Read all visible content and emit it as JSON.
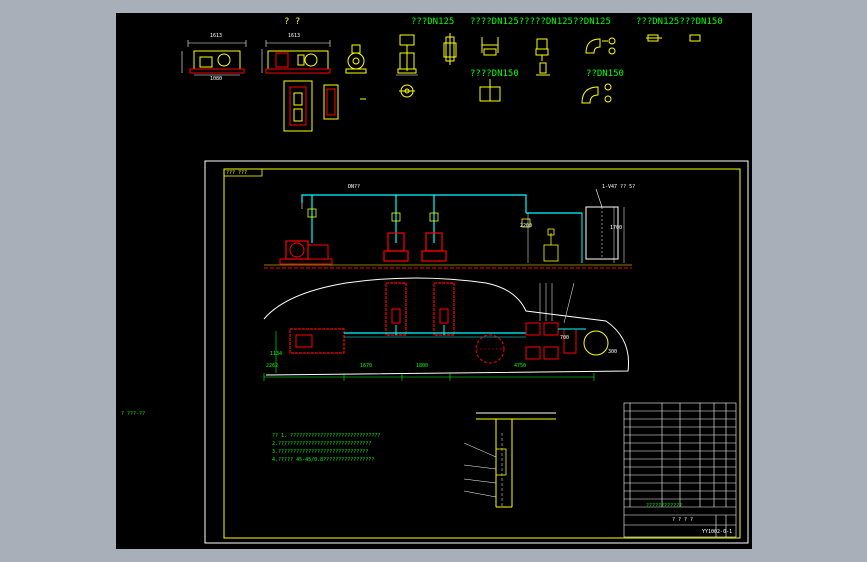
{
  "viewer": {
    "background": "#a9afb8",
    "canvas_color": "#000000"
  },
  "top_title": "? ?",
  "view_labels": [
    {
      "text": "???DN125"
    },
    {
      "text": "????DN125?????DN125??DN125"
    },
    {
      "text": "???DN125???DN150"
    },
    {
      "text": "????DN150"
    },
    {
      "text": "??DN150"
    }
  ],
  "dims": {
    "d1613a": "1613",
    "d1613b": "1613",
    "d1080": "1080",
    "d2262": "2262",
    "d1670": "1670",
    "d1800": "1800",
    "d4750": "4750",
    "d2200": "2200",
    "d1700": "1700",
    "d1134": "1134",
    "d700": "700",
    "d300": "300",
    "pipe_label": "DN??",
    "tank_label": "1-V47 ?? 5?"
  },
  "frame_tag": "??? ???",
  "side_note": "?  ???-??",
  "notes": [
    "?? 1. ??????????????????????????????",
    "   2.???????????????????????????????",
    "   3.??????????????????????????????",
    "   4.????? 45-45/0.8?????????????????"
  ],
  "title_block": {
    "drawing_title": "????????????",
    "drawing_subtitle": "? ? ? ?",
    "drawing_no": "YY1002-0-1"
  },
  "colors": {
    "frame": "#ffff00",
    "red_eq": "#ff0000",
    "pipe": "#00ffff",
    "text": "#00ff00",
    "white": "#ffffff"
  }
}
